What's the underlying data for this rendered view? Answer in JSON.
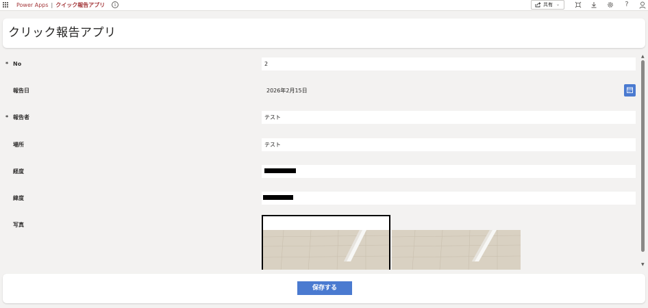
{
  "topbar": {
    "brand": "Power Apps",
    "separator": "|",
    "app_name": "クイック報告アプリ",
    "share_label": "共有"
  },
  "header": {
    "title": "クリック報告アプリ"
  },
  "form": {
    "rows": [
      {
        "label": "No",
        "required": "*",
        "value": "2"
      },
      {
        "label": "報告日",
        "required": "",
        "value": "2026年2月15日"
      },
      {
        "label": "報告者",
        "required": "*",
        "value": "テスト"
      },
      {
        "label": "場所",
        "required": "",
        "value": "テスト"
      },
      {
        "label": "経度",
        "required": "",
        "value": ""
      },
      {
        "label": "緯度",
        "required": "",
        "value": ""
      },
      {
        "label": "写真",
        "required": "",
        "value": ""
      }
    ]
  },
  "footer": {
    "save_label": "保存する"
  },
  "colors": {
    "brand": "#a4373a",
    "accent": "#4a7ad0",
    "background": "#f3f2f1"
  },
  "icons": {
    "app_launcher": "waffle-icon",
    "info": "info-icon",
    "share": "share-icon",
    "fit": "fit-to-screen-icon",
    "download": "download-icon",
    "settings": "gear-icon",
    "help": "help-icon",
    "account": "person-icon",
    "date_picker": "calendar-icon"
  }
}
